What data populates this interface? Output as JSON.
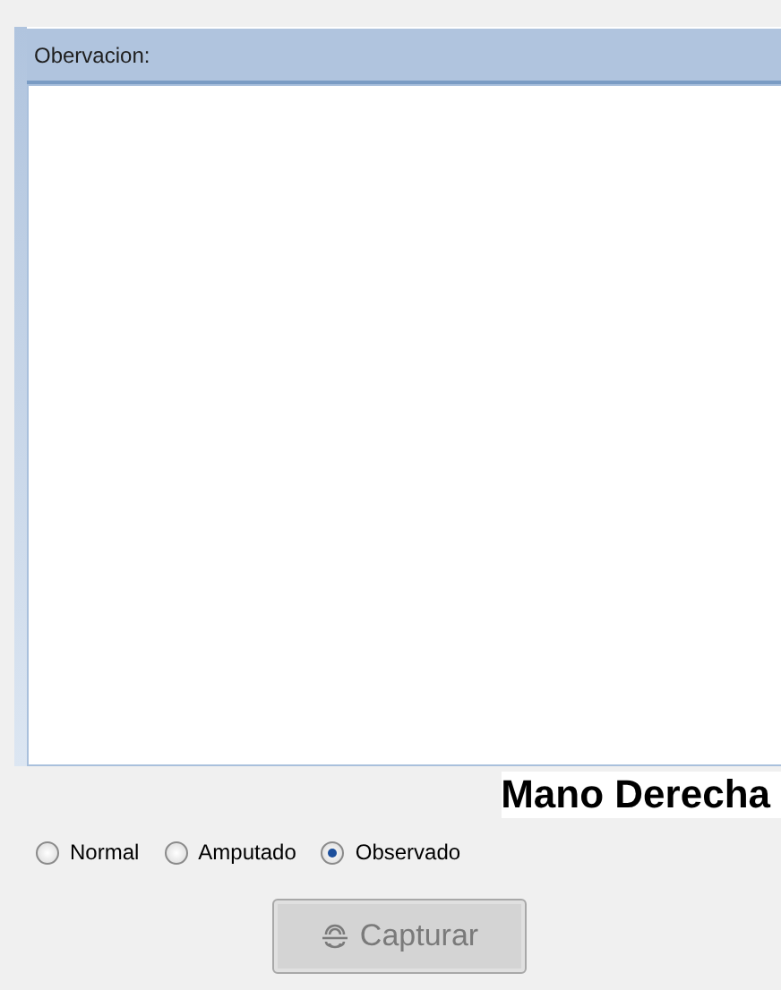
{
  "observation_panel": {
    "title": "Obervacion:"
  },
  "hand_title": "Mano Derecha",
  "options": [
    {
      "label": "Normal",
      "selected": false
    },
    {
      "label": "Amputado",
      "selected": false
    },
    {
      "label": "Observado",
      "selected": true
    }
  ],
  "capture_button": {
    "label": "Capturar",
    "disabled": true
  }
}
